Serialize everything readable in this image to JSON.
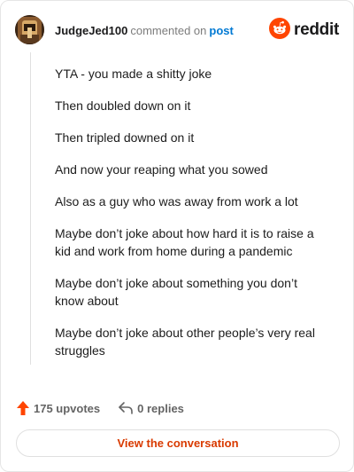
{
  "header": {
    "username": "JudgeJed100",
    "action": "commented on",
    "post_link": "post",
    "brand": "reddit"
  },
  "comment": {
    "paragraphs": [
      "YTA - you made a shitty joke",
      "Then doubled down on it",
      "Then tripled downed on it",
      "And now your reaping what you sowed",
      "Also as a guy who was away from work a lot",
      "Maybe don’t joke about how hard it is to raise a kid and work from home during a pandemic",
      "Maybe don’t joke about something you don’t know about",
      "Maybe don’t joke about other people’s very real struggles"
    ]
  },
  "footer": {
    "upvotes": "175 upvotes",
    "replies": "0 replies"
  },
  "cta": {
    "label": "View the conversation"
  },
  "colors": {
    "brand_orange": "#ff4500",
    "link_blue": "#0079d3",
    "cta_text": "#d93a00"
  },
  "icons": {
    "avatar": "user-avatar",
    "brand": "reddit-snoo-icon",
    "upvote": "upvote-arrow-icon",
    "reply": "reply-arrow-icon"
  }
}
